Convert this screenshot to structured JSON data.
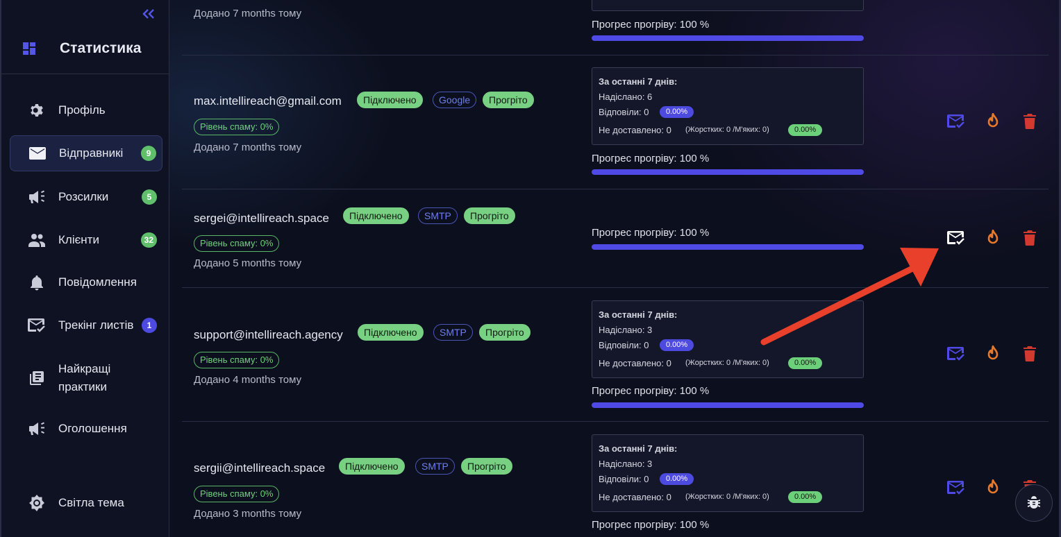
{
  "sidebar": {
    "title": "Статистика",
    "items": [
      {
        "label": "Профіль",
        "badge": ""
      },
      {
        "label": "Відправникі",
        "badge": "9"
      },
      {
        "label": "Розсилки",
        "badge": "5"
      },
      {
        "label": "Клієнти",
        "badge": "32"
      },
      {
        "label": "Повідомлення",
        "badge": ""
      },
      {
        "label": "Трекінг листів",
        "badge": "1"
      },
      {
        "label": "Найкращі",
        "label2": "практики",
        "badge": ""
      },
      {
        "label": "Оголошення",
        "badge": ""
      }
    ],
    "footer_label": "Світла тема"
  },
  "top_partial": {
    "added": "Додано 7 months тому",
    "progress_label": "Прогрес прогріву: 100 %",
    "progress": 100
  },
  "senders": [
    {
      "email": "max.intellireach@gmail.com",
      "tags": [
        "Підключено",
        "Google",
        "Прогріто"
      ],
      "spam": "Рівень спаму: 0%",
      "added": "Додано 7 months тому",
      "stats": {
        "title": "За останні 7 днів:",
        "sent": "Надіслано: 6",
        "replied": "Відповіли: 0",
        "replied_pct": "0.00%",
        "undelivered": "Не доставлено: 0",
        "undelivered_detail": "(Жорстких: 0 /М'яких: 0)",
        "undelivered_pct": "0.00%"
      },
      "progress_label": "Прогрес прогріву: 100 %",
      "progress": 100
    },
    {
      "email": "sergei@intellireach.space",
      "tags": [
        "Підключено",
        "SMTP",
        "Прогріто"
      ],
      "spam": "Рівень спаму: 0%",
      "added": "Додано 5 months тому",
      "progress_label": "Прогрес прогріву: 100 %",
      "progress": 100
    },
    {
      "email": "support@intellireach.agency",
      "tags": [
        "Підключено",
        "SMTP",
        "Прогріто"
      ],
      "spam": "Рівень спаму: 0%",
      "added": "Додано 4 months тому",
      "stats": {
        "title": "За останні 7 днів:",
        "sent": "Надіслано: 3",
        "replied": "Відповіли: 0",
        "replied_pct": "0.00%",
        "undelivered": "Не доставлено: 0",
        "undelivered_detail": "(Жорстких: 0 /М'яких: 0)",
        "undelivered_pct": "0.00%"
      },
      "progress_label": "Прогрес прогріву: 100 %",
      "progress": 100
    },
    {
      "email": "sergii@intellireach.space",
      "tags": [
        "Підключено",
        "SMTP",
        "Прогріто"
      ],
      "spam": "Рівень спаму: 0%",
      "added": "Додано 3 months тому",
      "stats": {
        "title": "За останні 7 днів:",
        "sent": "Надіслано: 3",
        "replied": "Відповіли: 0",
        "replied_pct": "0.00%",
        "undelivered": "Не доставлено: 0",
        "undelivered_detail": "(Жорстких: 0 /М'яких: 0)",
        "undelivered_pct": "0.00%"
      },
      "progress_label": "Прогрес прогріву: 100 %",
      "progress": 100
    }
  ],
  "colors": {
    "accent": "#4f49e6",
    "connected_tag": "#78d083",
    "warm_icon": "#e8782a",
    "delete_icon": "#d23a30",
    "annotation_arrow": "#e8402a"
  }
}
